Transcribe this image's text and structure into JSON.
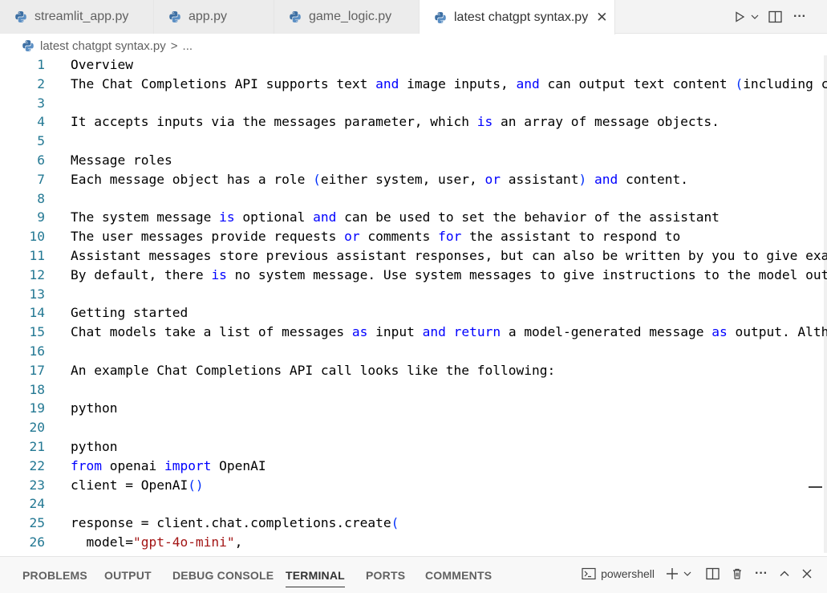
{
  "tabs": [
    {
      "label": "streamlit_app.py",
      "active": false
    },
    {
      "label": "app.py",
      "active": false
    },
    {
      "label": "game_logic.py",
      "active": false
    },
    {
      "label": "latest chatgpt syntax.py",
      "active": true
    }
  ],
  "tab_actions": {
    "run_icon": "play-icon",
    "split_icon": "split-editor-icon",
    "more": "···"
  },
  "breadcrumb": {
    "file": "latest chatgpt syntax.py",
    "separator": ">",
    "ellipsis": "..."
  },
  "editor": {
    "line_numbers": [
      "1",
      "2",
      "3",
      "4",
      "5",
      "6",
      "7",
      "8",
      "9",
      "10",
      "11",
      "12",
      "13",
      "14",
      "15",
      "16",
      "17",
      "18",
      "19",
      "20",
      "21",
      "22",
      "23",
      "24",
      "25",
      "26"
    ],
    "colors": {
      "keyword": "#0000ff",
      "string": "#a31515",
      "line_number": "#237893",
      "bracket": "#0431fa"
    }
  },
  "panel": {
    "tabs": [
      "PROBLEMS",
      "OUTPUT",
      "DEBUG CONSOLE",
      "TERMINAL",
      "PORTS",
      "COMMENTS"
    ],
    "active_tab": "TERMINAL",
    "shell": "powershell"
  }
}
